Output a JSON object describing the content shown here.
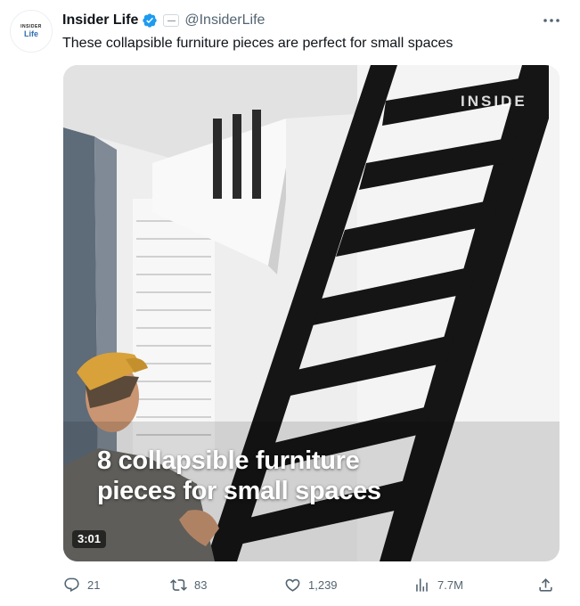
{
  "author": {
    "display_name": "Insider Life",
    "handle": "@InsiderLife",
    "avatar_top": "INSIDER",
    "avatar_bottom": "Life",
    "verified_color": "#1d9bf0"
  },
  "tweet": {
    "text": "These collapsible furniture pieces are perfect for small spaces"
  },
  "media": {
    "caption_line1": "8 collapsible furniture",
    "caption_line2": "pieces for small spaces",
    "watermark": "INSIDE",
    "duration": "3:01"
  },
  "actions": {
    "replies": "21",
    "reposts": "83",
    "likes": "1,239",
    "views": "7.7M"
  },
  "icons": {
    "more": "more-icon",
    "reply": "reply-icon",
    "repost": "repost-icon",
    "like": "like-icon",
    "views": "views-icon",
    "share": "share-icon"
  },
  "colors": {
    "text_primary": "#0f1419",
    "text_secondary": "#536471",
    "accent": "#1d9bf0"
  }
}
